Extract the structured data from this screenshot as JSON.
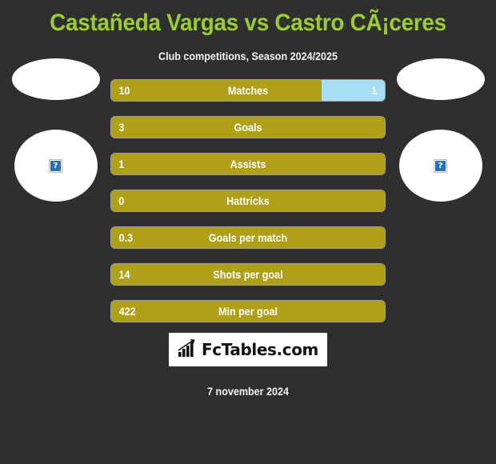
{
  "header": {
    "title": "Castañeda Vargas vs Castro CÃ¡ceres",
    "subtitle": "Club competitions, Season 2024/2025"
  },
  "colors": {
    "background": "#2f2f2f",
    "title_green": "#9ACD32",
    "bar_home_gold": "#B09F18",
    "bar_away_blue": "#A5DEF5",
    "text_white": "#FFFFFF"
  },
  "players": {
    "home": {
      "avatar_icon": "broken-image-icon",
      "avatar_glyph": "?"
    },
    "away": {
      "avatar_icon": "broken-image-icon",
      "avatar_glyph": "?"
    }
  },
  "chart_data": {
    "type": "bar",
    "title": "Castañeda Vargas vs Castro CÃ¡ceres",
    "subtitle": "Club competitions, Season 2024/2025",
    "categories": [
      "Matches",
      "Goals",
      "Assists",
      "Hattricks",
      "Goals per match",
      "Shots per goal",
      "Min per goal"
    ],
    "series": [
      {
        "name": "Castañeda Vargas",
        "color": "#B09F18",
        "values": [
          "10",
          "3",
          "1",
          "0",
          "0.3",
          "14",
          "422"
        ]
      },
      {
        "name": "Castro CÃ¡ceres",
        "color": "#A5DEF5",
        "values": [
          "1",
          "",
          "",
          "",
          "",
          "",
          ""
        ]
      }
    ],
    "home_fractions": [
      0.77,
      1,
      1,
      1,
      1,
      1,
      1
    ],
    "away_fractions": [
      0.23,
      0,
      0,
      0,
      0,
      0,
      0
    ],
    "grid": false,
    "legend": "none"
  },
  "rows": [
    {
      "label": "Matches",
      "home_value": "10",
      "away_value": "1",
      "home_fraction": 0.77,
      "away_fraction": 0.23
    },
    {
      "label": "Goals",
      "home_value": "3",
      "away_value": "",
      "home_fraction": 1,
      "away_fraction": 0
    },
    {
      "label": "Assists",
      "home_value": "1",
      "away_value": "",
      "home_fraction": 1,
      "away_fraction": 0
    },
    {
      "label": "Hattricks",
      "home_value": "0",
      "away_value": "",
      "home_fraction": 1,
      "away_fraction": 0
    },
    {
      "label": "Goals per match",
      "home_value": "0.3",
      "away_value": "",
      "home_fraction": 1,
      "away_fraction": 0
    },
    {
      "label": "Shots per goal",
      "home_value": "14",
      "away_value": "",
      "home_fraction": 1,
      "away_fraction": 0
    },
    {
      "label": "Min per goal",
      "home_value": "422",
      "away_value": "",
      "home_fraction": 1,
      "away_fraction": 0
    }
  ],
  "footer": {
    "logo_text": "FcTables.com",
    "logo_icon": "bar-chart-arrow-icon",
    "date": "7 november 2024"
  }
}
